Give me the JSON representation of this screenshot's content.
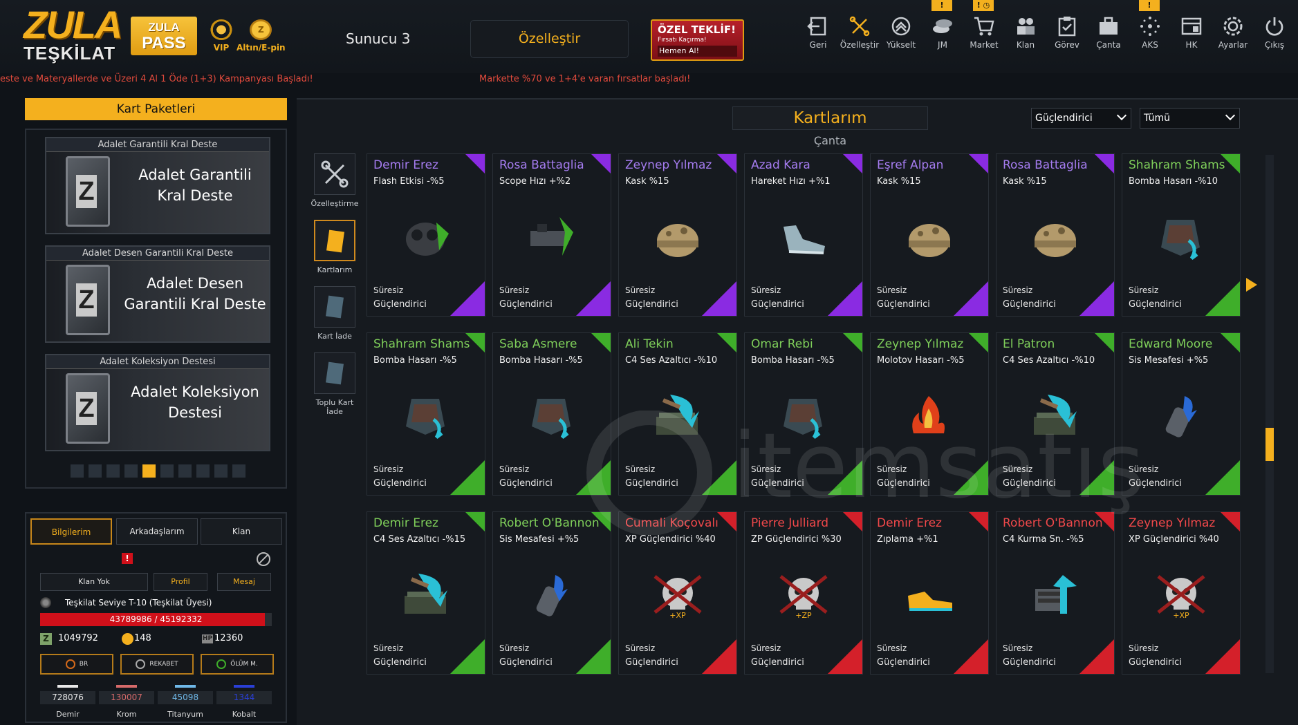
{
  "brand": {
    "logo_top": "ZULA",
    "logo_bottom": "TEŞKİLAT",
    "pass_l1": "ZULA",
    "pass_l2": "PASS",
    "vip": "VIP",
    "gold": "Altın/E-pin"
  },
  "server": "Sunucu 3",
  "customize": "Özelleştir",
  "offer": {
    "l1": "ÖZEL TEKLİF!",
    "l2": "Fırsatı Kaçırma!",
    "l3": "Hemen Al!"
  },
  "nav": [
    {
      "label": "Geri",
      "icon": "back-icon",
      "badge": ""
    },
    {
      "label": "Özelleştir",
      "icon": "tools-icon",
      "badge": ""
    },
    {
      "label": "Yükselt",
      "icon": "upgrade-icon",
      "badge": ""
    },
    {
      "label": "JM",
      "icon": "coins-icon",
      "badge": "!"
    },
    {
      "label": "Market",
      "icon": "cart-icon",
      "badge": ""
    },
    {
      "label": "Klan",
      "icon": "clan-icon",
      "badge": ""
    },
    {
      "label": "Görev",
      "icon": "clipboard-icon",
      "badge": ""
    },
    {
      "label": "Çanta",
      "icon": "bag-icon",
      "badge": ""
    },
    {
      "label": "AKS",
      "icon": "aks-icon",
      "badge": "!"
    },
    {
      "label": "HK",
      "icon": "hk-icon",
      "badge": ""
    },
    {
      "label": "Ayarlar",
      "icon": "gear-icon",
      "badge": ""
    },
    {
      "label": "Çıkış",
      "icon": "power-icon",
      "badge": ""
    }
  ],
  "nav_extra_badge": "! ◷",
  "tickers": [
    "este ve Materyallerde ve Üzeri 4 Al 1 Öde (1+3) Kampanyası Başladı!",
    "Markette %70 ve 1+4'e varan fırsatlar başladı!"
  ],
  "packs": {
    "title": "Kart Paketleri",
    "items": [
      {
        "header": "Adalet Garantili Kral Deste",
        "name": "Adalet Garantili Kral Deste"
      },
      {
        "header": "Adalet Desen Garantili Kral Deste",
        "name": "Adalet Desen Garantili Kral Deste"
      },
      {
        "header": "Adalet Koleksiyon Destesi",
        "name": "Adalet Koleksiyon Destesi"
      }
    ],
    "page_count": 10,
    "active_page": 4
  },
  "profile": {
    "tabs": [
      "Bilgilerim",
      "Arkadaşlarım",
      "Klan"
    ],
    "active_tab": 0,
    "clan": "Klan Yok",
    "profile_btn": "Profil",
    "message_btn": "Mesaj",
    "rank": "Teşkilat Seviye T-10 (Teşkilat Üyesi)",
    "xp_text": "43789986 / 45192332",
    "xp_fraction": 0.969,
    "currency": {
      "z": "1049792",
      "gold": "148",
      "hp": "12360"
    },
    "modes": [
      "BR",
      "REKABET",
      "ÖLÜM M."
    ],
    "materials": [
      {
        "name": "Demir",
        "value": "728076",
        "color": "#e8e8e8"
      },
      {
        "name": "Krom",
        "value": "130007",
        "color": "#d66a6a"
      },
      {
        "name": "Titanyum",
        "value": "45098",
        "color": "#6fb8e8"
      },
      {
        "name": "Kobalt",
        "value": "1344",
        "color": "#2a3fd6"
      }
    ]
  },
  "main": {
    "title": "Kartlarım",
    "subtitle": "Çanta",
    "filter1": "Güçlendirici",
    "filter2": "Tümü",
    "tools": [
      "Özelleştirme",
      "Kartlarım",
      "Kart İade",
      "Toplu Kart İade"
    ]
  },
  "colors": {
    "purple": "#8a2be2",
    "green": "#3fae2a",
    "red": "#d4202a",
    "purple_text": "#a57cf0",
    "green_text": "#7fcf5a",
    "red_text": "#f0484a"
  },
  "cards": [
    {
      "name": "Demir Erez",
      "stat": "Flash Etkisi -%5",
      "rarity": "purple",
      "img": "gas-mask"
    },
    {
      "name": "Rosa Battaglia",
      "stat": "Scope Hızı +%2",
      "rarity": "purple",
      "img": "scope"
    },
    {
      "name": "Zeynep Yılmaz",
      "stat": "Kask %15",
      "rarity": "purple",
      "img": "helmet"
    },
    {
      "name": "Azad Kara",
      "stat": "Hareket Hızı +%1",
      "rarity": "purple",
      "img": "shoe"
    },
    {
      "name": "Eşref Alpan",
      "stat": "Kask %15",
      "rarity": "purple",
      "img": "helmet"
    },
    {
      "name": "Rosa Battaglia",
      "stat": "Kask %15",
      "rarity": "purple",
      "img": "helmet"
    },
    {
      "name": "Shahram Shams",
      "stat": "Bomba Hasarı -%10",
      "rarity": "green",
      "img": "vest"
    },
    {
      "name": "Shahram Shams",
      "stat": "Bomba Hasarı -%5",
      "rarity": "green",
      "img": "vest"
    },
    {
      "name": "Saba Asmere",
      "stat": "Bomba Hasarı -%5",
      "rarity": "green",
      "img": "vest"
    },
    {
      "name": "Ali Tekin",
      "stat": "C4 Ses Azaltıcı -%10",
      "rarity": "green",
      "img": "c4"
    },
    {
      "name": "Omar Rebi",
      "stat": "Bomba Hasarı -%5",
      "rarity": "green",
      "img": "vest"
    },
    {
      "name": "Zeynep Yılmaz",
      "stat": "Molotov Hasarı -%5",
      "rarity": "green",
      "img": "fire"
    },
    {
      "name": "El Patron",
      "stat": "C4 Ses Azaltıcı -%10",
      "rarity": "green",
      "img": "c4"
    },
    {
      "name": "Edward Moore",
      "stat": "Sis Mesafesi +%5",
      "rarity": "green",
      "img": "smoke"
    },
    {
      "name": "Demir Erez",
      "stat": "C4 Ses Azaltıcı -%15",
      "rarity": "green",
      "img": "c4"
    },
    {
      "name": "Robert O'Bannon",
      "stat": "Sis Mesafesi +%5",
      "rarity": "green",
      "img": "smoke"
    },
    {
      "name": "Cumali Koçovalı",
      "stat": "XP Güçlendirici %40",
      "rarity": "red",
      "img": "skull-xp"
    },
    {
      "name": "Pierre Julliard",
      "stat": "ZP Güçlendirici %30",
      "rarity": "red",
      "img": "skull-zp"
    },
    {
      "name": "Demir Erez",
      "stat": "Zıplama +%1",
      "rarity": "red",
      "img": "shoe-gold"
    },
    {
      "name": "Robert O'Bannon",
      "stat": "C4 Kurma Sn. -%5",
      "rarity": "red",
      "img": "c4-box"
    },
    {
      "name": "Zeynep Yılmaz",
      "stat": "XP Güçlendirici %40",
      "rarity": "red",
      "img": "skull-xp"
    }
  ],
  "card_duration": "Süresiz",
  "card_type": "Güçlendirici",
  "watermark": "itemsatış"
}
